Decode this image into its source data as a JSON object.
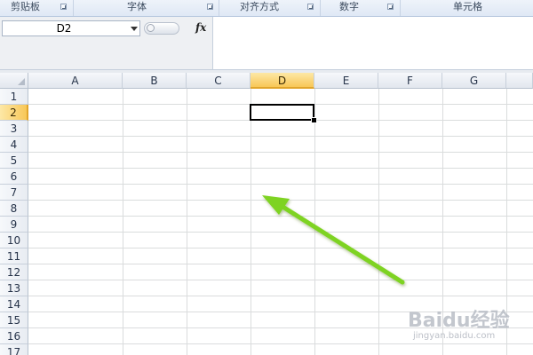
{
  "ribbon": {
    "groups": [
      {
        "label": "剪贴板"
      },
      {
        "label": "字体"
      },
      {
        "label": "对齐方式"
      },
      {
        "label": "数字"
      },
      {
        "label": "单元格"
      }
    ]
  },
  "formula_bar": {
    "name_box": "D2",
    "fx_label": "fx",
    "formula_value": ""
  },
  "grid": {
    "columns": [
      "A",
      "B",
      "C",
      "D",
      "E",
      "F",
      "G"
    ],
    "rows": [
      "1",
      "2",
      "3",
      "4",
      "5",
      "6",
      "7",
      "8",
      "9",
      "10",
      "11",
      "12",
      "13",
      "14",
      "15",
      "16",
      "17"
    ],
    "selected_column": "D",
    "selected_row": "2",
    "active_cell": "D2"
  },
  "annotation": {
    "arrow_color": "#7ed321",
    "arrow_icon": "arrow-icon"
  },
  "watermark": {
    "main": "Baidu经验",
    "sub": "jingyan.baidu.com"
  },
  "colors": {
    "selected_header": "#f8c757",
    "gridline": "#dadcdd",
    "ribbon_bg": "#dfe8f5"
  }
}
